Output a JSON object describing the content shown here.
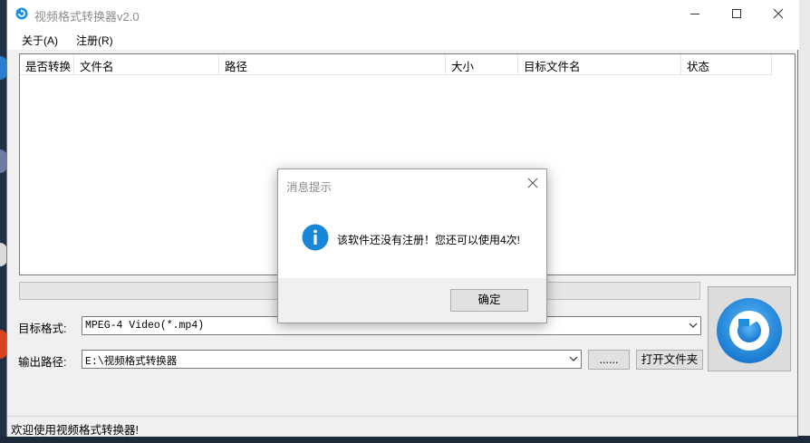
{
  "window": {
    "title": "视频格式转换器v2.0"
  },
  "menu": [
    {
      "label": "关于(A)"
    },
    {
      "label": "注册(R)"
    }
  ],
  "table": {
    "columns": [
      "是否转换",
      "文件名",
      "路径",
      "大小",
      "目标文件名",
      "状态"
    ],
    "rows": []
  },
  "form": {
    "target_format_label": "目标格式:",
    "target_format_value": "MPEG-4 Video(*.mp4)",
    "output_path_label": "输出路径:",
    "output_path_value": "E:\\视频格式转换器",
    "browse_label": "......",
    "open_folder_label": "打开文件夹"
  },
  "status": {
    "text": "欢迎使用视频格式转换器!"
  },
  "dialog": {
    "title": "消息提示",
    "message": "该软件还没有注册！您还可以使用4次!",
    "ok_label": "确定",
    "icon": "info-icon"
  },
  "colors": {
    "accent": "#1a86d8",
    "convert_icon": "#1e8fe0"
  }
}
